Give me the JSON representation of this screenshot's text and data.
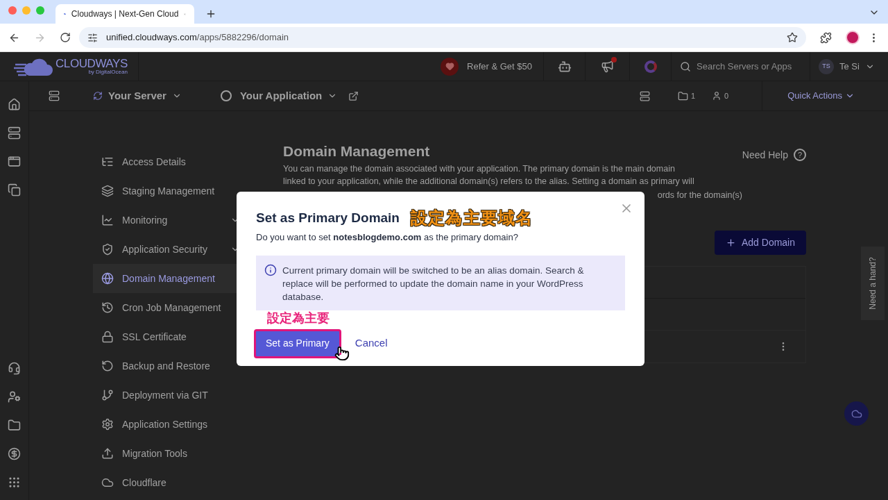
{
  "browser": {
    "tab_title": "Cloudways | Next-Gen Cloud",
    "url_host": "unified.cloudways.com",
    "url_path": "/apps/5882296/domain",
    "forward_disabled": true
  },
  "header": {
    "logo_text": "CLOUDWAYS",
    "logo_sub": "by DigitalOcean",
    "refer": "Refer & Get $50",
    "notification_dot": true,
    "search_placeholder": "Search Servers or Apps",
    "avatar_initials": "TS",
    "user_name": "Te Si"
  },
  "subheader": {
    "server": "Your Server",
    "application": "Your Application",
    "folder_count": "1",
    "user_count": "0",
    "quick_actions": "Quick Actions"
  },
  "sidebar": {
    "items": [
      {
        "label": "Access Details",
        "selected": false,
        "has_submenu": false
      },
      {
        "label": "Staging Management",
        "selected": false,
        "has_submenu": false
      },
      {
        "label": "Monitoring",
        "selected": false,
        "has_submenu": true
      },
      {
        "label": "Application Security",
        "selected": false,
        "has_submenu": true
      },
      {
        "label": "Domain Management",
        "selected": true,
        "has_submenu": false
      },
      {
        "label": "Cron Job Management",
        "selected": false,
        "has_submenu": false
      },
      {
        "label": "SSL Certificate",
        "selected": false,
        "has_submenu": false
      },
      {
        "label": "Backup and Restore",
        "selected": false,
        "has_submenu": false
      },
      {
        "label": "Deployment via GIT",
        "selected": false,
        "has_submenu": false
      },
      {
        "label": "Application Settings",
        "selected": false,
        "has_submenu": false
      },
      {
        "label": "Migration Tools",
        "selected": false,
        "has_submenu": false
      },
      {
        "label": "Cloudflare",
        "selected": false,
        "has_submenu": false
      }
    ]
  },
  "main": {
    "title": "Domain Management",
    "description_lines": [
      "You can manage the domain associated with your application. The primary domain is the main domain",
      "linked to your application, while the additional domain(s) refers to the alias. Setting a domain as primary will"
    ],
    "description_fragment": "ords for the domain(s)",
    "need_help": "Need Help",
    "need_help_icon": "?",
    "add_domain": "Add Domain"
  },
  "dialog": {
    "title": "Set as Primary Domain",
    "question": "Do you want to set **notesblogdemo.com** as the primary domain?",
    "info": "Current primary domain will be switched to be an alias domain. Search & replace will be performed to update the domain name in your WordPress database.",
    "primary": "Set as Primary",
    "cancel": "Cancel"
  },
  "annotations": {
    "title_note": "設定為主要域名",
    "button_note": "設定為主要"
  },
  "help_tab": "Need a hand?"
}
